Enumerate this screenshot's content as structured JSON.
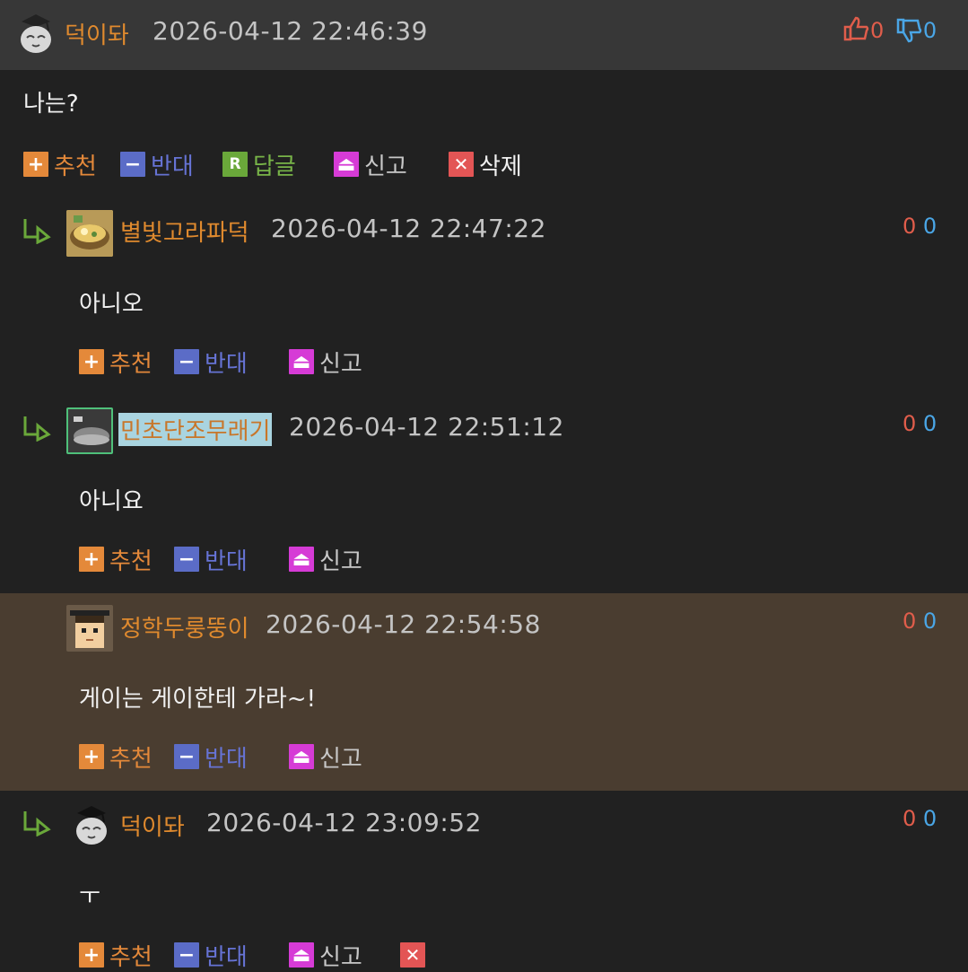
{
  "labels": {
    "recommend": "추천",
    "oppose": "반대",
    "reply": "답글",
    "report": "신고",
    "delete": "삭제"
  },
  "colors": {
    "up": "#e05d4b",
    "down": "#4aa6e6",
    "nick": "#e08a2e",
    "highlight_bg": "#4a3d30"
  },
  "comments": [
    {
      "nick": "덕이돠",
      "date": "2026-04-12 22:46:39",
      "up": "0",
      "down": "0",
      "body": "나는?",
      "avatar": "owl-avatar"
    },
    {
      "nick": "별빛고라파덕",
      "date": "2026-04-12 22:47:22",
      "up": "0",
      "down": "0",
      "body": "아니오",
      "avatar": "food-avatar"
    },
    {
      "nick": "민초단조무래기",
      "date": "2026-04-12 22:51:12",
      "up": "0",
      "down": "0",
      "body": "아니요",
      "avatar": "shoe-avatar"
    },
    {
      "nick": "정학두룽뚱이",
      "date": "2026-04-12 22:54:58",
      "up": "0",
      "down": "0",
      "body": "게이는 게이한테 가라~!",
      "avatar": "pixel-face-avatar"
    },
    {
      "nick": "덕이돠",
      "date": "2026-04-12 23:09:52",
      "up": "0",
      "down": "0",
      "body": "ㅜ",
      "avatar": "owl-avatar"
    }
  ]
}
